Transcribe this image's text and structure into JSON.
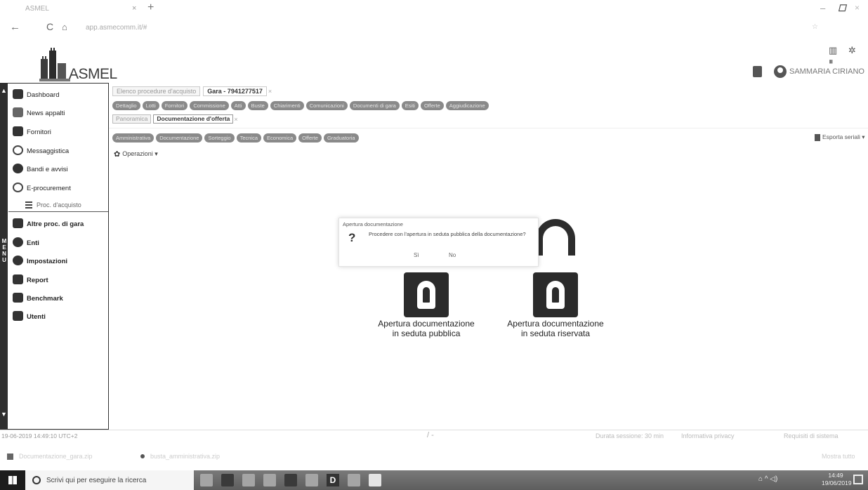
{
  "browser": {
    "tab_title": "ASMEL",
    "tab_close": "×",
    "new_tab": "+",
    "back": "←",
    "reload": "C",
    "home": "⌂",
    "url": "app.asmecomm.it/#",
    "address_right": "☆",
    "window_min": "–",
    "window_max": "☐",
    "window_close": "×",
    "app_icons": "▥ ✲ ⏸"
  },
  "header": {
    "logo_text": "ASMEL",
    "user_name": "SAMMARIA CIRIANO"
  },
  "sidebar": {
    "menu_label": "M E N U",
    "items": [
      {
        "label": "Dashboard",
        "icon": "home-icon"
      },
      {
        "label": "News appalti",
        "icon": "scales-icon"
      },
      {
        "label": "Fornitori",
        "icon": "truck-icon"
      },
      {
        "label": "Messaggistica",
        "icon": "at-icon"
      },
      {
        "label": "Bandi e avvisi",
        "icon": "megaphone-icon"
      },
      {
        "label": "E-procurement",
        "icon": "handshake-icon"
      },
      {
        "label": "Altre proc. di gara",
        "icon": "database-icon"
      },
      {
        "label": "Enti",
        "icon": "users-icon"
      },
      {
        "label": "Impostazioni",
        "icon": "gear-icon"
      },
      {
        "label": "Report",
        "icon": "chart-icon"
      },
      {
        "label": "Benchmark",
        "icon": "document-icon"
      },
      {
        "label": "Utenti",
        "icon": "user-card-icon"
      }
    ],
    "submenu": {
      "label": "Proc. d'acquisto",
      "icon": "list-icon"
    }
  },
  "content": {
    "path_tabs": [
      {
        "label": "Elenco procedure d'acquisto",
        "active": false
      },
      {
        "label": "Gara - 7941277517",
        "active": true
      }
    ],
    "path_close": "×",
    "pill_row1": [
      "Dettaglio",
      "Lotti",
      "Fornitori",
      "Commissione",
      "Atti",
      "Buste",
      "Chiarimenti",
      "Comunicazioni",
      "Documenti di gara",
      "Esiti",
      "Offerte",
      "Aggiudicazione"
    ],
    "subtabs": [
      {
        "label": "Panoramica",
        "active": false
      },
      {
        "label": "Documentazione d'offerta",
        "active": true
      }
    ],
    "subtab_close": "×",
    "pill_row2": [
      "Amministrativa",
      "Documentazione",
      "Sorteggio",
      "Tecnica",
      "Economica",
      "Offerte",
      "Graduatoria"
    ],
    "operations": "Operazioni ▾",
    "export": "Esporta seriali ▾"
  },
  "locks": [
    {
      "label": "Apertura documentazione in seduta pubblica"
    },
    {
      "label": "Apertura documentazione in seduta riservata"
    }
  ],
  "dialog": {
    "title": "Apertura documentazione",
    "question_mark": "?",
    "message": "Procedere con l'apertura in seduta pubblica della documentazione?",
    "yes": "Sì",
    "no": "No"
  },
  "footer": {
    "datetime": "19-06-2019 14:49:10 UTC+2",
    "mid": "/ -",
    "session": "Durata sessione: 30 min",
    "privacy": "Informativa privacy",
    "requirements": "Requisiti di sistema"
  },
  "downloads": {
    "file1": "Documentazione_gara.zip",
    "file2": "busta_amministrativa.zip",
    "show_all": "Mostra tutto"
  },
  "taskbar": {
    "search_placeholder": "Scrivi qui per eseguire la ricerca",
    "app_letter": "D",
    "tray": "⌂ ^ ◁)",
    "time": "14:49",
    "date": "19/06/2019"
  }
}
